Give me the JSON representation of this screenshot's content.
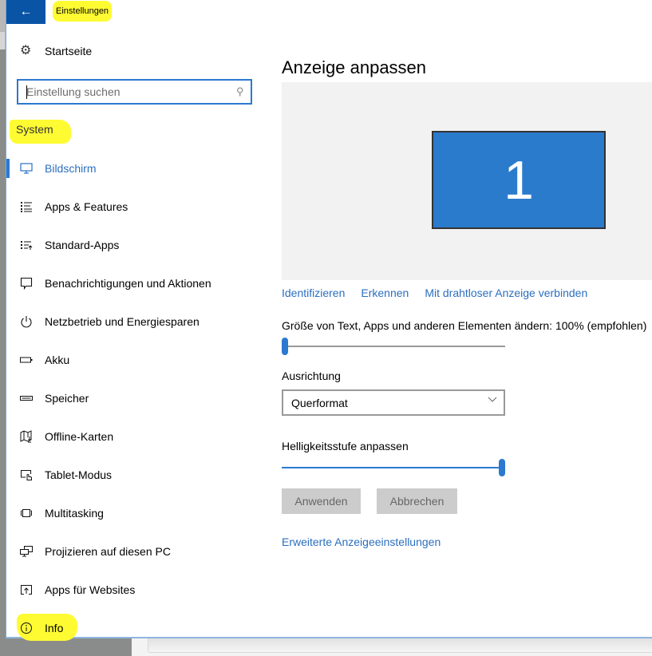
{
  "window": {
    "title": "Einstellungen",
    "back_icon": "back-arrow-icon"
  },
  "nav": {
    "home": {
      "label": "Startseite",
      "icon": "gear-icon"
    },
    "search": {
      "placeholder": "Einstellung suchen",
      "value": "",
      "icon": "search-icon"
    },
    "section": "System",
    "items": [
      {
        "label": "Bildschirm",
        "icon": "monitor-icon",
        "active": true
      },
      {
        "label": "Apps & Features",
        "icon": "list-icon"
      },
      {
        "label": "Standard-Apps",
        "icon": "default-apps-icon"
      },
      {
        "label": "Benachrichtigungen und Aktionen",
        "icon": "notification-icon"
      },
      {
        "label": "Netzbetrieb und Energiesparen",
        "icon": "power-icon"
      },
      {
        "label": "Akku",
        "icon": "battery-icon"
      },
      {
        "label": "Speicher",
        "icon": "storage-icon"
      },
      {
        "label": "Offline-Karten",
        "icon": "map-icon"
      },
      {
        "label": "Tablet-Modus",
        "icon": "tablet-mode-icon"
      },
      {
        "label": "Multitasking",
        "icon": "multitasking-icon"
      },
      {
        "label": "Projizieren auf diesen PC",
        "icon": "project-icon"
      },
      {
        "label": "Apps für Websites",
        "icon": "apps-websites-icon"
      },
      {
        "label": "Info",
        "icon": "info-icon"
      }
    ]
  },
  "main": {
    "title": "Anzeige anpassen",
    "display_number": "1",
    "links": [
      "Identifizieren",
      "Erkennen",
      "Mit drahtloser Anzeige verbinden"
    ],
    "scale_label": "Größe von Text, Apps und anderen Elementen ändern: 100% (empfohlen)",
    "scale_slider_percent": 0,
    "orientation_label": "Ausrichtung",
    "orientation_value": "Querformat",
    "brightness_label": "Helligkeitsstufe anpassen",
    "brightness_percent": 100,
    "apply_label": "Anwenden",
    "cancel_label": "Abbrechen",
    "advanced_link": "Erweiterte Anzeigeeinstellungen"
  },
  "colors": {
    "accent": "#2b79d0",
    "titlebar": "#0a54a6",
    "highlight": "#fffb33"
  }
}
